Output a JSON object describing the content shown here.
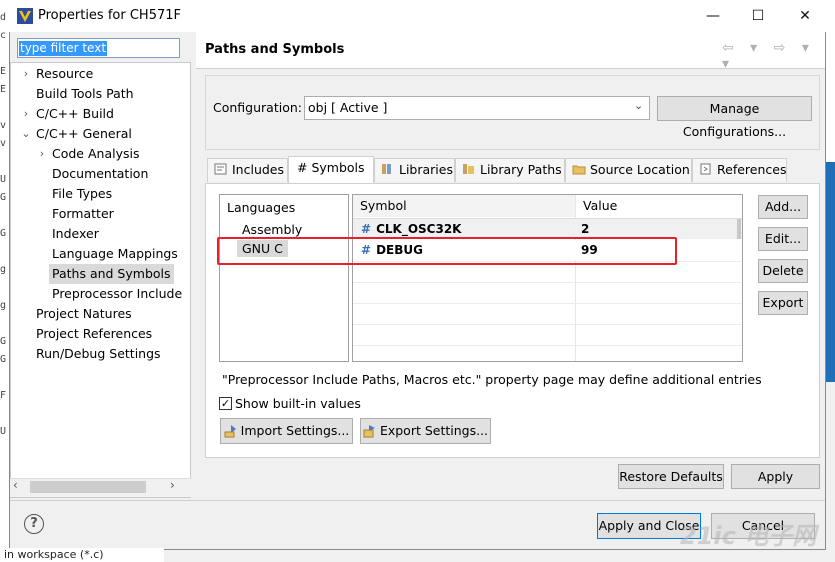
{
  "window": {
    "title": "Properties for CH571F",
    "minimize_glyph": "—",
    "maximize_glyph": "☐",
    "close_glyph": "✕"
  },
  "background": {
    "left_chars": [
      "d",
      "c",
      "",
      "E",
      "E",
      "",
      "v",
      "v",
      "",
      "U",
      "G",
      "",
      "G",
      "",
      "g",
      "",
      "g",
      "",
      "G",
      "G",
      "",
      "F",
      "",
      "U"
    ],
    "bottom_text": "in workspace (*.c)"
  },
  "left_panel": {
    "filter_placeholder": "type filter text",
    "tree": [
      {
        "label": "Resource",
        "arrow": "›"
      },
      {
        "label": "Build Tools Path",
        "arrow": ""
      },
      {
        "label": "C/C++ Build",
        "arrow": "›"
      },
      {
        "label": "C/C++ General",
        "arrow": "⌄"
      },
      {
        "label": "Code Analysis",
        "arrow": "›"
      },
      {
        "label": "Documentation",
        "arrow": ""
      },
      {
        "label": "File Types",
        "arrow": ""
      },
      {
        "label": "Formatter",
        "arrow": ""
      },
      {
        "label": "Indexer",
        "arrow": ""
      },
      {
        "label": "Language Mappings",
        "arrow": ""
      },
      {
        "label": "Paths and Symbols",
        "arrow": "",
        "selected": true
      },
      {
        "label": "Preprocessor Include",
        "arrow": ""
      },
      {
        "label": "Project Natures",
        "arrow": ""
      },
      {
        "label": "Project References",
        "arrow": ""
      },
      {
        "label": "Run/Debug Settings",
        "arrow": ""
      }
    ]
  },
  "page": {
    "title": "Paths and Symbols",
    "nav_icons": "⇦ ▾ ⇨ ▾ ▾",
    "configuration_label": "Configuration:",
    "configuration_value": "obj  [ Active ]",
    "manage_button": "Manage Configurations...",
    "tabs": [
      "Includes",
      "# Symbols",
      "Libraries",
      "Library Paths",
      "Source Location",
      "References"
    ],
    "languages_header": "Languages",
    "languages": [
      "Assembly",
      "GNU C"
    ],
    "table_headers": [
      "Symbol",
      "Value"
    ],
    "symbols": [
      {
        "symbol": "CLK_OSC32K",
        "value": "2"
      },
      {
        "symbol": "DEBUG",
        "value": "99"
      }
    ],
    "side_buttons": [
      "Add...",
      "Edit...",
      "Delete",
      "Export"
    ],
    "info_text": "\"Preprocessor Include Paths, Macros etc.\" property page may define additional entries",
    "show_builtin_label": "Show built-in values",
    "show_builtin_checked": "✓",
    "import_button": "Import Settings...",
    "export_settings_button": "Export Settings...",
    "restore_button": "Restore Defaults",
    "apply_button": "Apply"
  },
  "footer": {
    "help_glyph": "?",
    "apply_close_button": "Apply and Close",
    "cancel_button": "Cancel",
    "watermark": "21ic 电子网"
  },
  "colors": {
    "selection": "#3399ff",
    "highlight_box": "#e8202a",
    "symbol_hash": "#3a6fb5",
    "accent_right": "#1f6fb8"
  }
}
